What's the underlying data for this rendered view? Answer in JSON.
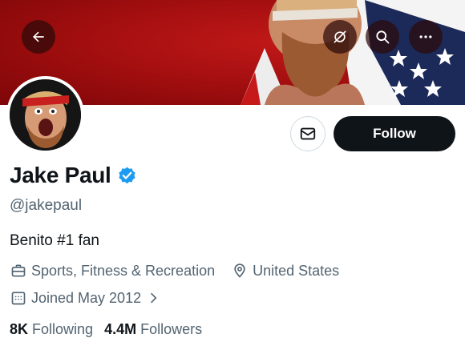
{
  "profile": {
    "name": "Jake Paul",
    "handle": "@jakepaul",
    "bio": "Benito #1 fan",
    "category": "Sports, Fitness & Recreation",
    "location": "United States",
    "joined": "Joined May 2012",
    "verified": true,
    "following_count": "8K",
    "following_label": "Following",
    "followers_count": "4.4M",
    "followers_label": "Followers"
  },
  "actions": {
    "follow_label": "Follow"
  },
  "icons": {
    "back": "arrow-left-icon",
    "hide": "eye-slash-icon",
    "search": "search-icon",
    "more": "more-horizontal-icon",
    "message": "envelope-icon",
    "category": "briefcase-icon",
    "location": "location-pin-icon",
    "joined": "calendar-icon",
    "verified": "verified-badge-icon"
  },
  "colors": {
    "banner": "#a50f10",
    "follow_button": "#0f1419",
    "verified": "#1d9bf0",
    "secondary_text": "#536471"
  }
}
